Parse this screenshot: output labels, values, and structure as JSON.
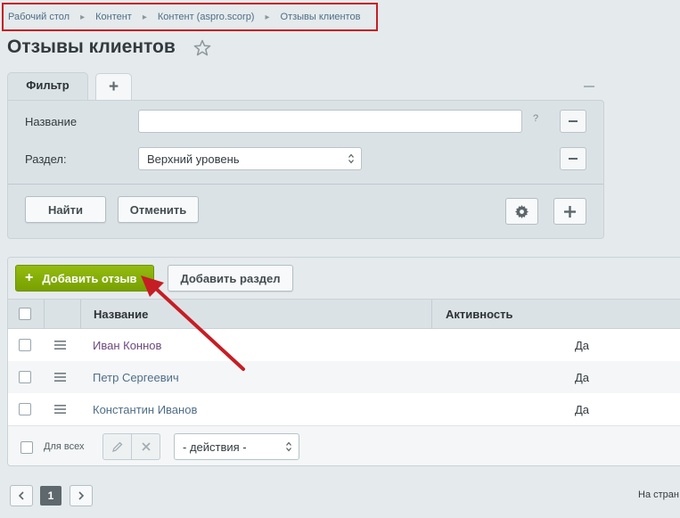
{
  "breadcrumb": {
    "items": [
      "Рабочий стол",
      "Контент",
      "Контент (aspro.scorp)",
      "Отзывы клиентов"
    ]
  },
  "page": {
    "title": "Отзывы клиентов"
  },
  "filter": {
    "tab_label": "Фильтр",
    "add_tab_label": "+",
    "fields": [
      {
        "label": "Название",
        "value": "",
        "help": "?"
      },
      {
        "label": "Раздел:",
        "value": "Верхний уровень"
      }
    ],
    "find_label": "Найти",
    "cancel_label": "Отменить"
  },
  "list": {
    "add_review_label": "Добавить отзыв",
    "add_section_label": "Добавить раздел",
    "columns": [
      "Название",
      "Активность"
    ],
    "rows": [
      {
        "name": "Иван Коннов",
        "active": "Да"
      },
      {
        "name": "Петр Сергеевич",
        "active": "Да"
      },
      {
        "name": "Константин Иванов",
        "active": "Да"
      }
    ],
    "footer": {
      "for_all_label": "Для всех",
      "actions_value": "- действия -"
    }
  },
  "pagination": {
    "current_page": "1",
    "per_page_label": "На стран"
  },
  "colors": {
    "accent_green": "#86ad00",
    "annotation_red": "#c51e24",
    "link": "#4f6e88",
    "visited_link": "#6b4a7e"
  }
}
